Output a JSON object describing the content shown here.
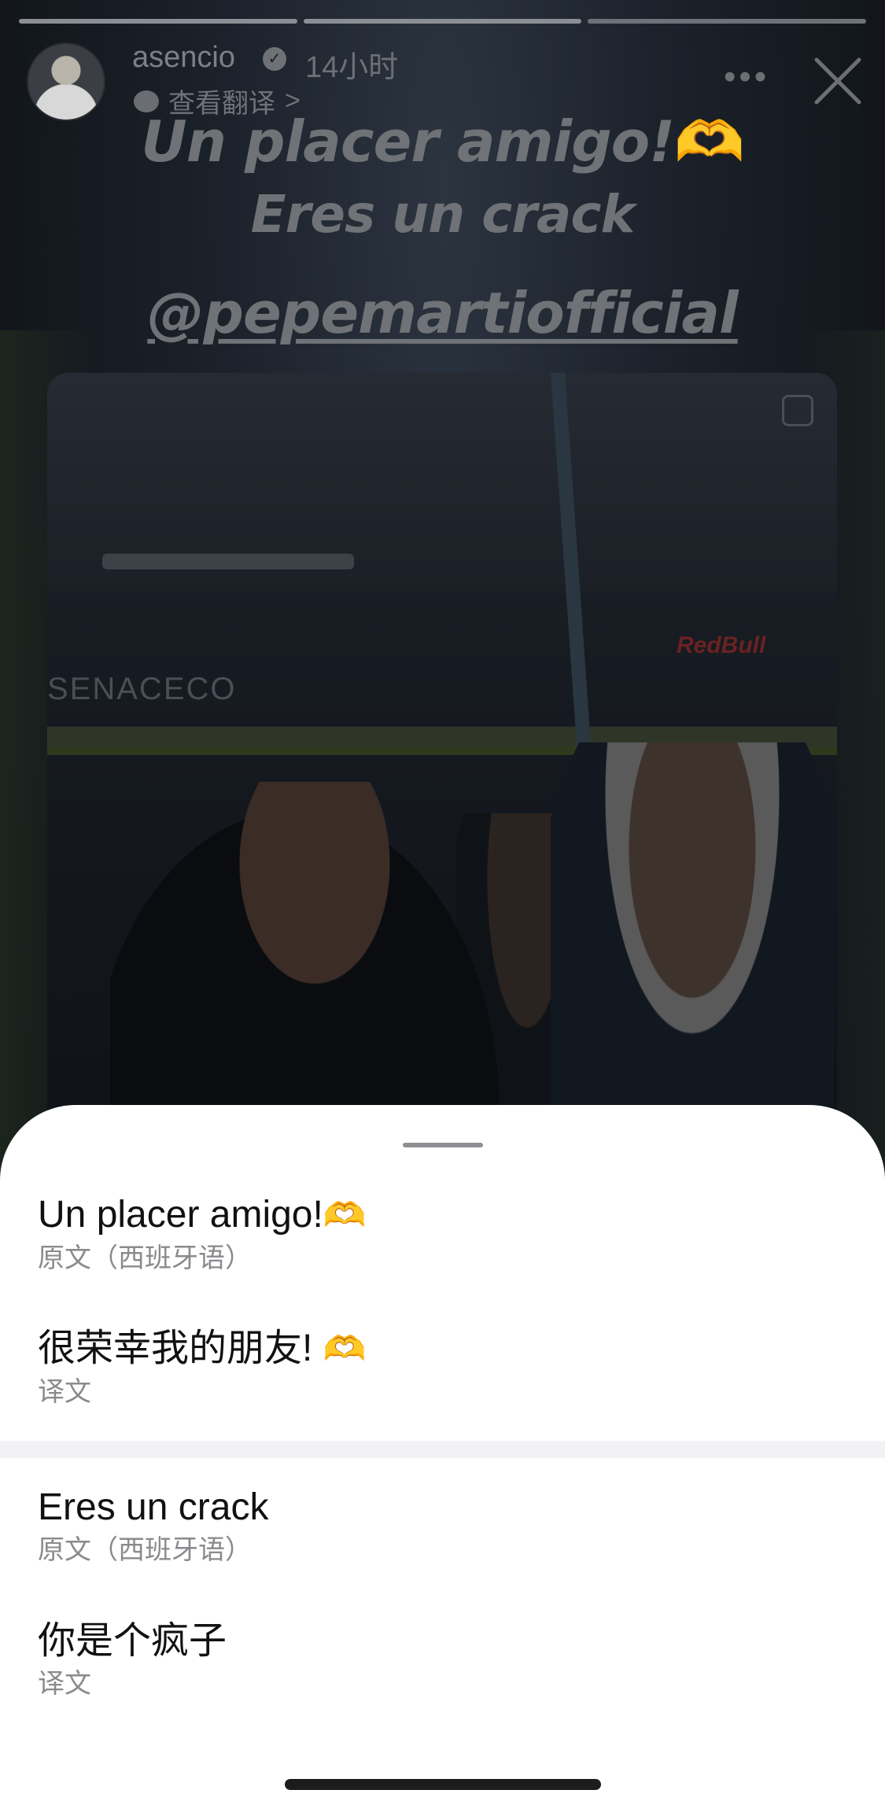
{
  "story": {
    "username": "asencio",
    "time_ago": "14小时",
    "see_translation_label": "查看翻译",
    "chevron": ">",
    "more_label": "•••",
    "line1_text": "Un placer amigo!",
    "line1_emoji": "🫶",
    "line2_text": "Eres un crack",
    "line3_text": "@pepemartiofficial",
    "photo": {
      "sign_text": "SENACECO",
      "cap_logo_text": "RedBull"
    }
  },
  "translation_sheet": {
    "items": [
      {
        "text": "Un placer amigo!",
        "emoji": "🫶",
        "label": "原文（西班牙语）"
      },
      {
        "text": "很荣幸我的朋友! ",
        "emoji": "🫶",
        "label": "译文"
      },
      {
        "text": "Eres un crack",
        "emoji": "",
        "label": "原文（西班牙语）"
      },
      {
        "text": "你是个疯子",
        "emoji": "",
        "label": "译文"
      }
    ]
  },
  "colors": {
    "sheet_bg": "#ffffff",
    "primary_text": "#111111",
    "secondary_text": "#8a8a8e",
    "overlay_text": "#6f7276"
  }
}
